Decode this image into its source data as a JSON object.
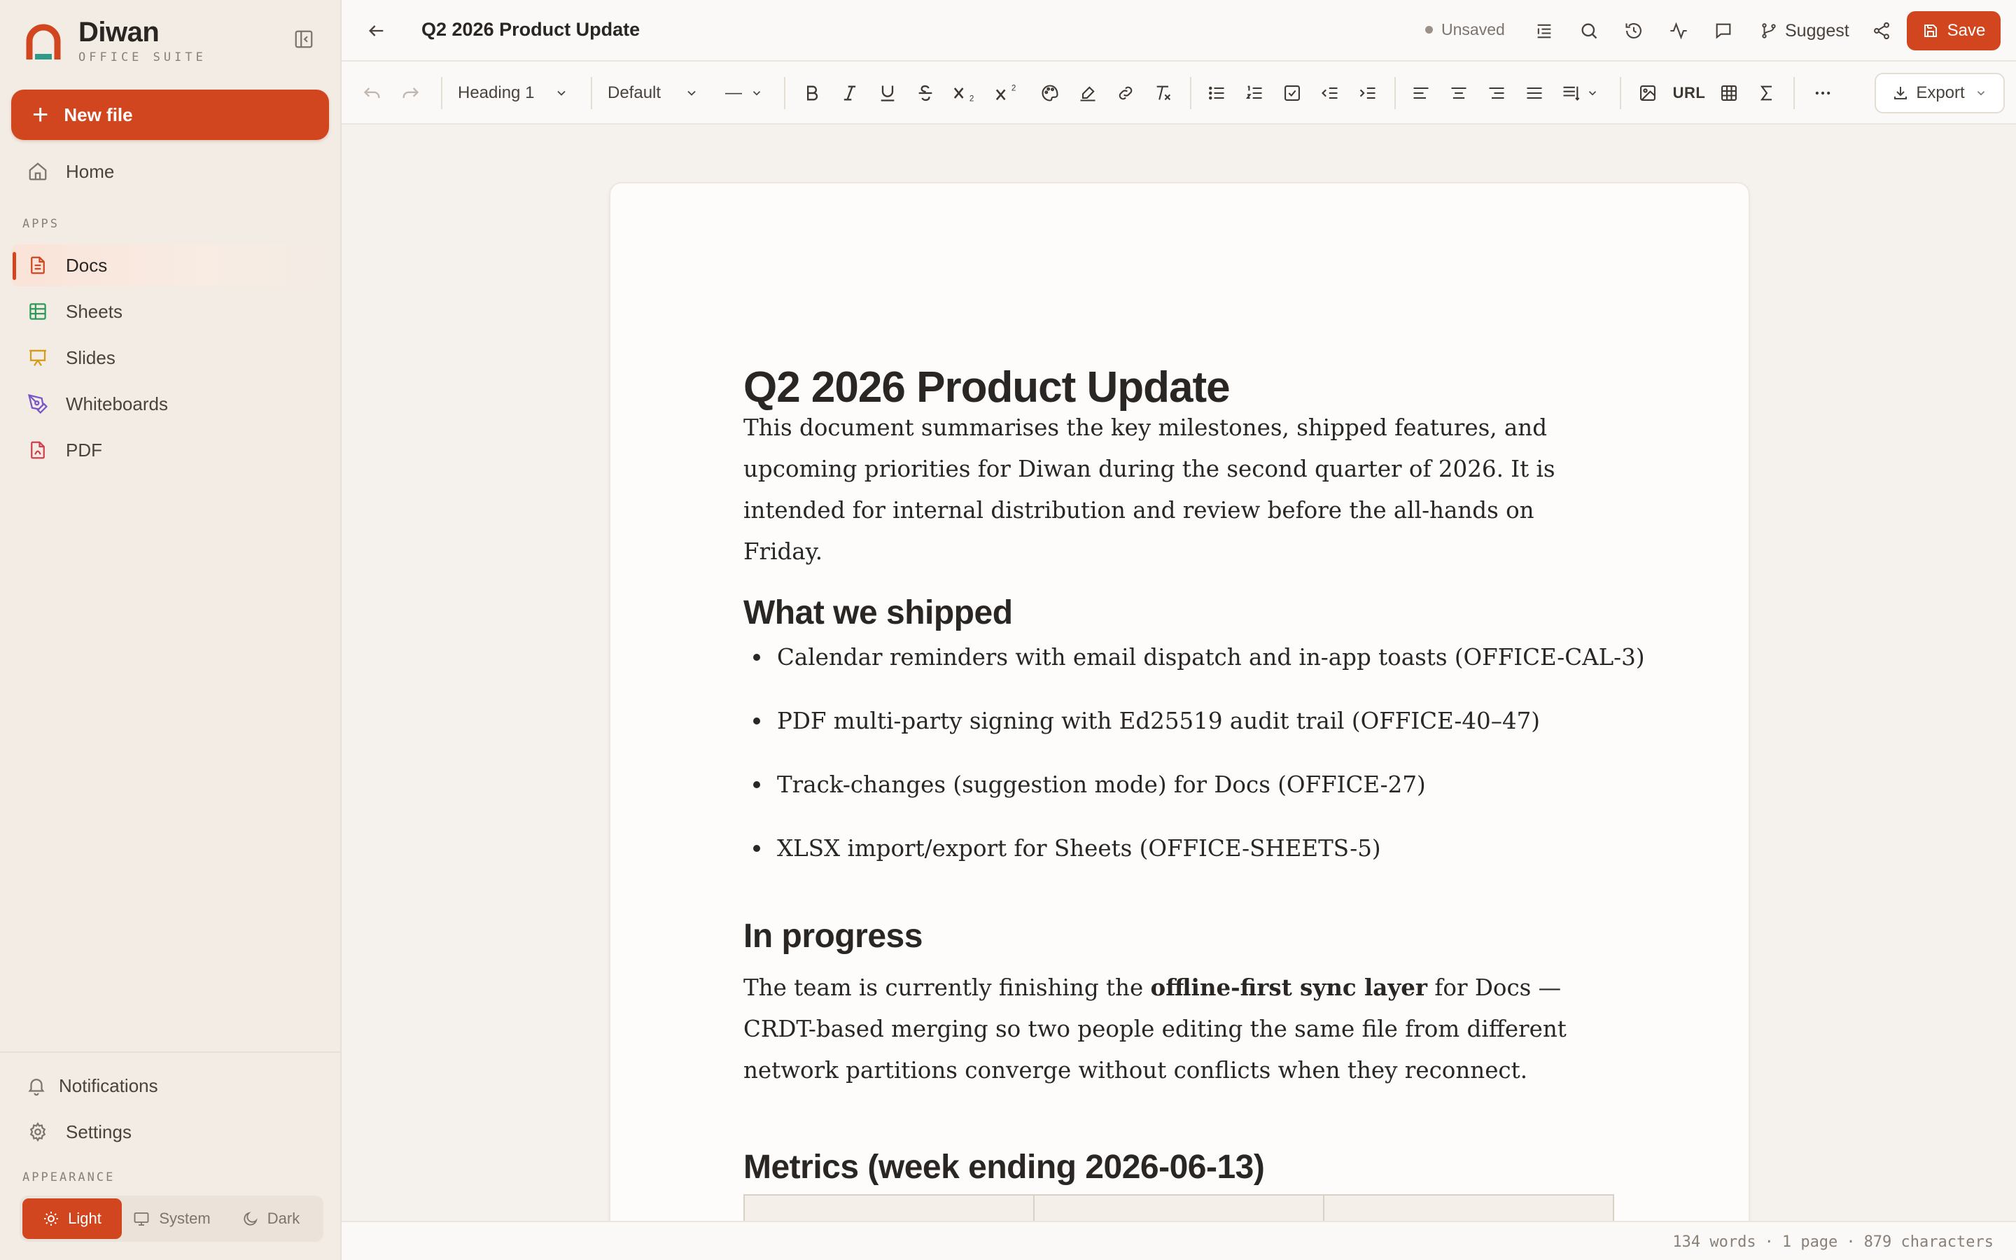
{
  "app": {
    "name": "Diwan",
    "subtitle": "OFFICE SUITE",
    "accent": "#d2461f"
  },
  "sidebar": {
    "new_file_label": "New file",
    "home_label": "Home",
    "apps_section": "APPS",
    "items": [
      {
        "label": "Docs",
        "icon": "doc-icon",
        "color": "#d2461f",
        "active": true
      },
      {
        "label": "Sheets",
        "icon": "sheet-icon",
        "color": "#2e9a5a"
      },
      {
        "label": "Slides",
        "icon": "slides-icon",
        "color": "#d79a1a"
      },
      {
        "label": "Whiteboards",
        "icon": "pen-icon",
        "color": "#7a55c7"
      },
      {
        "label": "PDF",
        "icon": "pdf-icon",
        "color": "#d23f4a"
      }
    ],
    "notifications_label": "Notifications",
    "settings_label": "Settings",
    "appearance_section": "APPEARANCE",
    "theme": {
      "light": "Light",
      "system": "System",
      "dark": "Dark",
      "selected": "Light"
    }
  },
  "topbar": {
    "title": "Q2 2026 Product Update",
    "status": "Unsaved",
    "suggest_label": "Suggest",
    "save_label": "Save"
  },
  "toolbar": {
    "block_style": "Heading 1",
    "font": "Default",
    "font_size": "—",
    "url_label": "URL",
    "export_label": "Export"
  },
  "document": {
    "title": "Q2 2026 Product Update",
    "intro": "This document summarises the key milestones, shipped features, and upcoming priorities for Diwan during the second quarter of 2026. It is intended for internal distribution and review before the all-hands on Friday.",
    "shipped_heading": "What we shipped",
    "shipped_items": [
      "Calendar reminders with email dispatch and in-app toasts (OFFICE-CAL-3)",
      "PDF multi-party signing with Ed25519 audit trail (OFFICE-40–47)",
      "Track-changes (suggestion mode) for Docs (OFFICE-27)",
      "XLSX import/export for Sheets (OFFICE-SHEETS-5)"
    ],
    "progress_heading": "In progress",
    "progress_text_before": "The team is currently finishing the ",
    "progress_text_bold": "offline-first sync layer",
    "progress_text_after": " for Docs — CRDT-based merging so two people editing the same file from different network partitions converge without conflicts when they reconnect.",
    "metrics_heading": "Metrics (week ending 2026-06-13)"
  },
  "status": {
    "words": "134 words",
    "pages": "1 page",
    "characters": "879 characters"
  }
}
